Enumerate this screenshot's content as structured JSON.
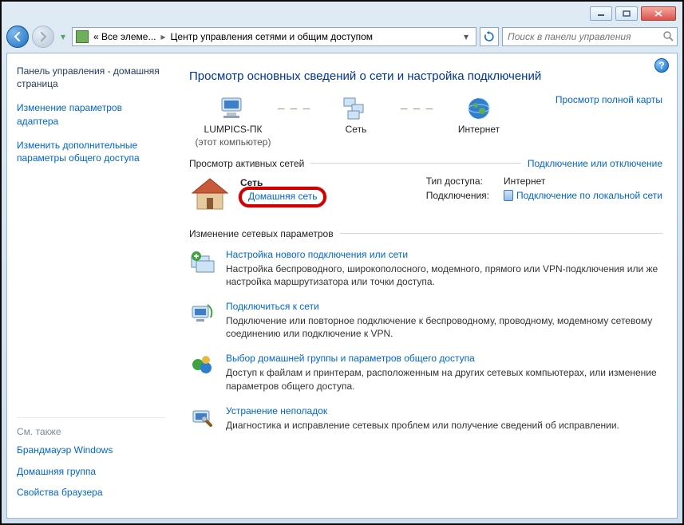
{
  "window": {
    "minimize_tip": "Minimize",
    "maximize_tip": "Maximize",
    "close_tip": "Close"
  },
  "address": {
    "crumb1": "« Все элеме...",
    "crumb2": "Центр управления сетями и общим доступом",
    "search_placeholder": "Поиск в панели управления"
  },
  "sidebar": {
    "home": "Панель управления - домашняя страница",
    "links": [
      "Изменение параметров адаптера",
      "Изменить дополнительные параметры общего доступа"
    ],
    "see_also_label": "См. также",
    "see_also": [
      "Брандмауэр Windows",
      "Домашняя группа",
      "Свойства браузера"
    ]
  },
  "main": {
    "title": "Просмотр основных сведений о сети и настройка подключений",
    "full_map": "Просмотр полной карты",
    "nodes": {
      "pc": "LUMPICS-ПК",
      "pc_sub": "(этот компьютер)",
      "network": "Сеть",
      "internet": "Интернет"
    },
    "section_active": "Просмотр активных сетей",
    "connect_link": "Подключение или отключение",
    "active": {
      "name": "Сеть",
      "type": "Домашняя сеть",
      "k1": "Тип доступа:",
      "v1": "Интернет",
      "k2": "Подключения:",
      "v2": "Подключение по локальной сети"
    },
    "section_change": "Изменение сетевых параметров",
    "opts": [
      {
        "title": "Настройка нового подключения или сети",
        "desc": "Настройка беспроводного, широкополосного, модемного, прямого или VPN-подключения или же настройка маршрутизатора или точки доступа."
      },
      {
        "title": "Подключиться к сети",
        "desc": "Подключение или повторное подключение к беспроводному, проводному, модемному сетевому соединению или подключение к VPN."
      },
      {
        "title": "Выбор домашней группы и параметров общего доступа",
        "desc": "Доступ к файлам и принтерам, расположенным на других сетевых компьютерах, или изменение параметров общего доступа."
      },
      {
        "title": "Устранение неполадок",
        "desc": "Диагностика и исправление сетевых проблем или получение сведений об исправлении."
      }
    ]
  }
}
